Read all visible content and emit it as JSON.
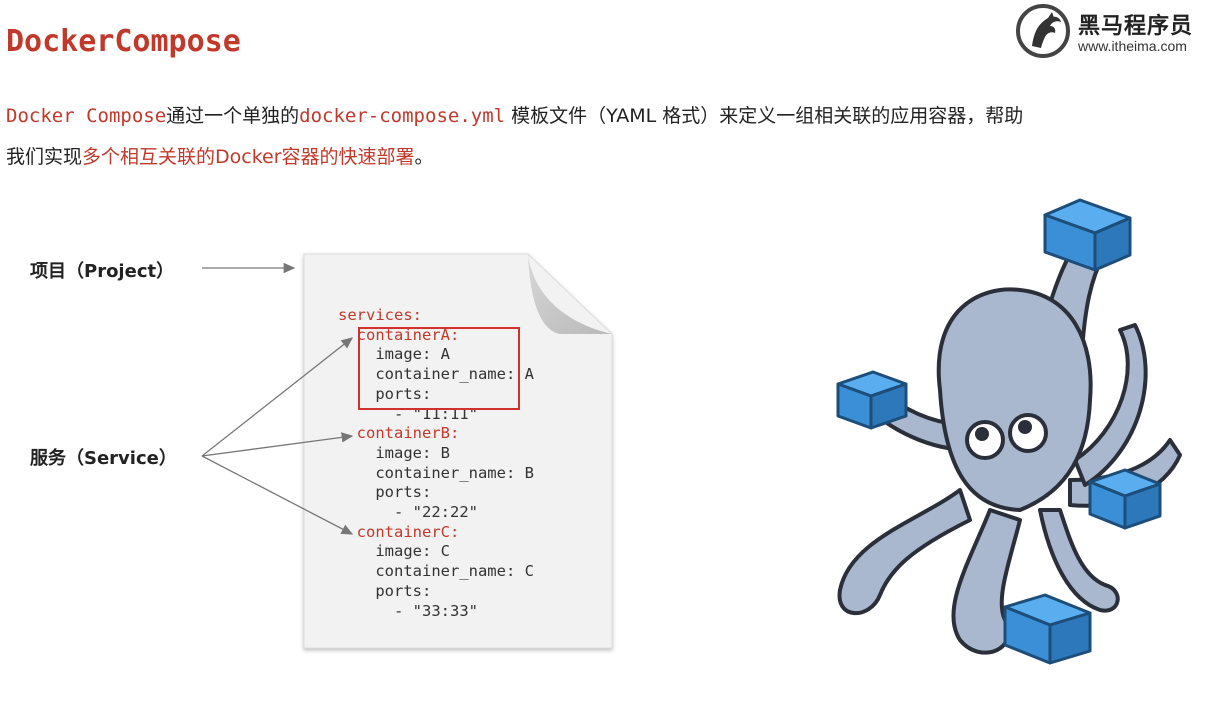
{
  "slide": {
    "title": "DockerCompose",
    "logo": {
      "name": "黑马程序员",
      "url": "www.itheima.com"
    },
    "intro": {
      "line1_mono": "Docker Compose",
      "line1_text_a": "通过一个单独的",
      "line1_file": "docker-compose.yml",
      "line1_text_b": " 模板文件（YAML 格式）来定义一组相关联的应用容器，帮助",
      "line2_text": "我们实现",
      "line2_highlight": "多个相互关联的Docker容器的快速部署",
      "line2_end": "。"
    },
    "labels": {
      "project": "项目（Project）",
      "service": "服务（Service）"
    },
    "code": {
      "services_key": "services:",
      "lines": [
        {
          "key": "containerA:",
          "indent": 1
        },
        {
          "text": "image: A",
          "indent": 2
        },
        {
          "text": "container_name: A",
          "indent": 2
        },
        {
          "text": "ports:",
          "indent": 2
        },
        {
          "text": "- \"11:11\"",
          "indent": 3
        },
        {
          "key": "containerB:",
          "indent": 1
        },
        {
          "text": "image: B",
          "indent": 2
        },
        {
          "text": "container_name: B",
          "indent": 2
        },
        {
          "text": "ports:",
          "indent": 2
        },
        {
          "text": "- \"22:22\"",
          "indent": 3
        },
        {
          "key": "containerC:",
          "indent": 1
        },
        {
          "text": "image: C",
          "indent": 2
        },
        {
          "text": "container_name: C",
          "indent": 2
        },
        {
          "text": "ports:",
          "indent": 2
        },
        {
          "text": "- \"33:33\"",
          "indent": 3
        }
      ]
    },
    "colors": {
      "accent": "#c0392b",
      "box": "#d0312d",
      "octopus": "#a9b8cf",
      "cube": "#3b8fd6"
    },
    "icons": {
      "logo": "horse-logo-icon",
      "mascot": "docker-compose-octopus-icon"
    }
  }
}
